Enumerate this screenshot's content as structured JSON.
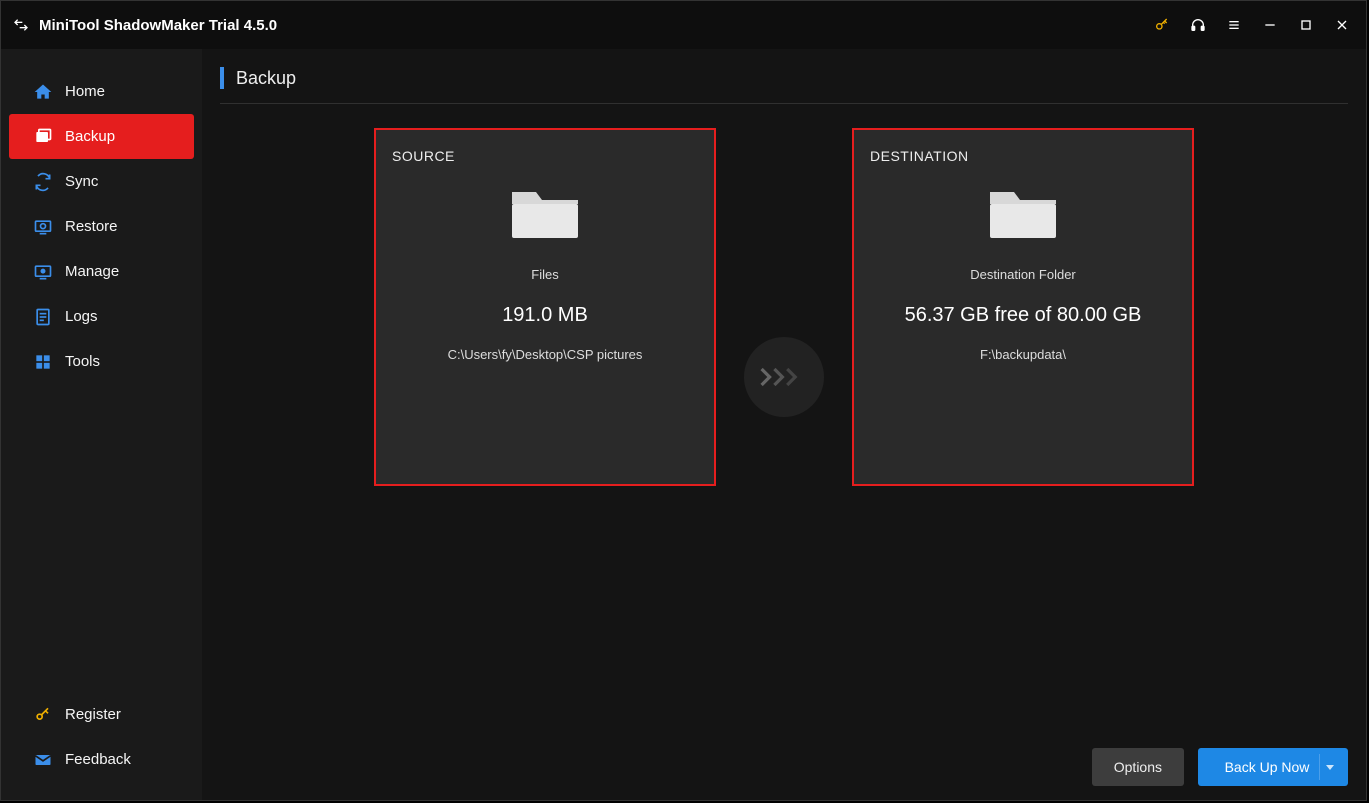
{
  "app": {
    "title": "MiniTool ShadowMaker Trial 4.5.0"
  },
  "sidebar": {
    "items": [
      {
        "id": "home",
        "label": "Home"
      },
      {
        "id": "backup",
        "label": "Backup"
      },
      {
        "id": "sync",
        "label": "Sync"
      },
      {
        "id": "restore",
        "label": "Restore"
      },
      {
        "id": "manage",
        "label": "Manage"
      },
      {
        "id": "logs",
        "label": "Logs"
      },
      {
        "id": "tools",
        "label": "Tools"
      }
    ],
    "bottom": {
      "register": "Register",
      "feedback": "Feedback"
    }
  },
  "page": {
    "title": "Backup"
  },
  "source": {
    "heading": "SOURCE",
    "type_label": "Files",
    "size": "191.0 MB",
    "path": "C:\\Users\\fy\\Desktop\\CSP pictures"
  },
  "destination": {
    "heading": "DESTINATION",
    "type_label": "Destination Folder",
    "free_text": "56.37 GB free of 80.00 GB",
    "path": "F:\\backupdata\\"
  },
  "footer": {
    "options": "Options",
    "backup_now": "Back Up Now"
  }
}
